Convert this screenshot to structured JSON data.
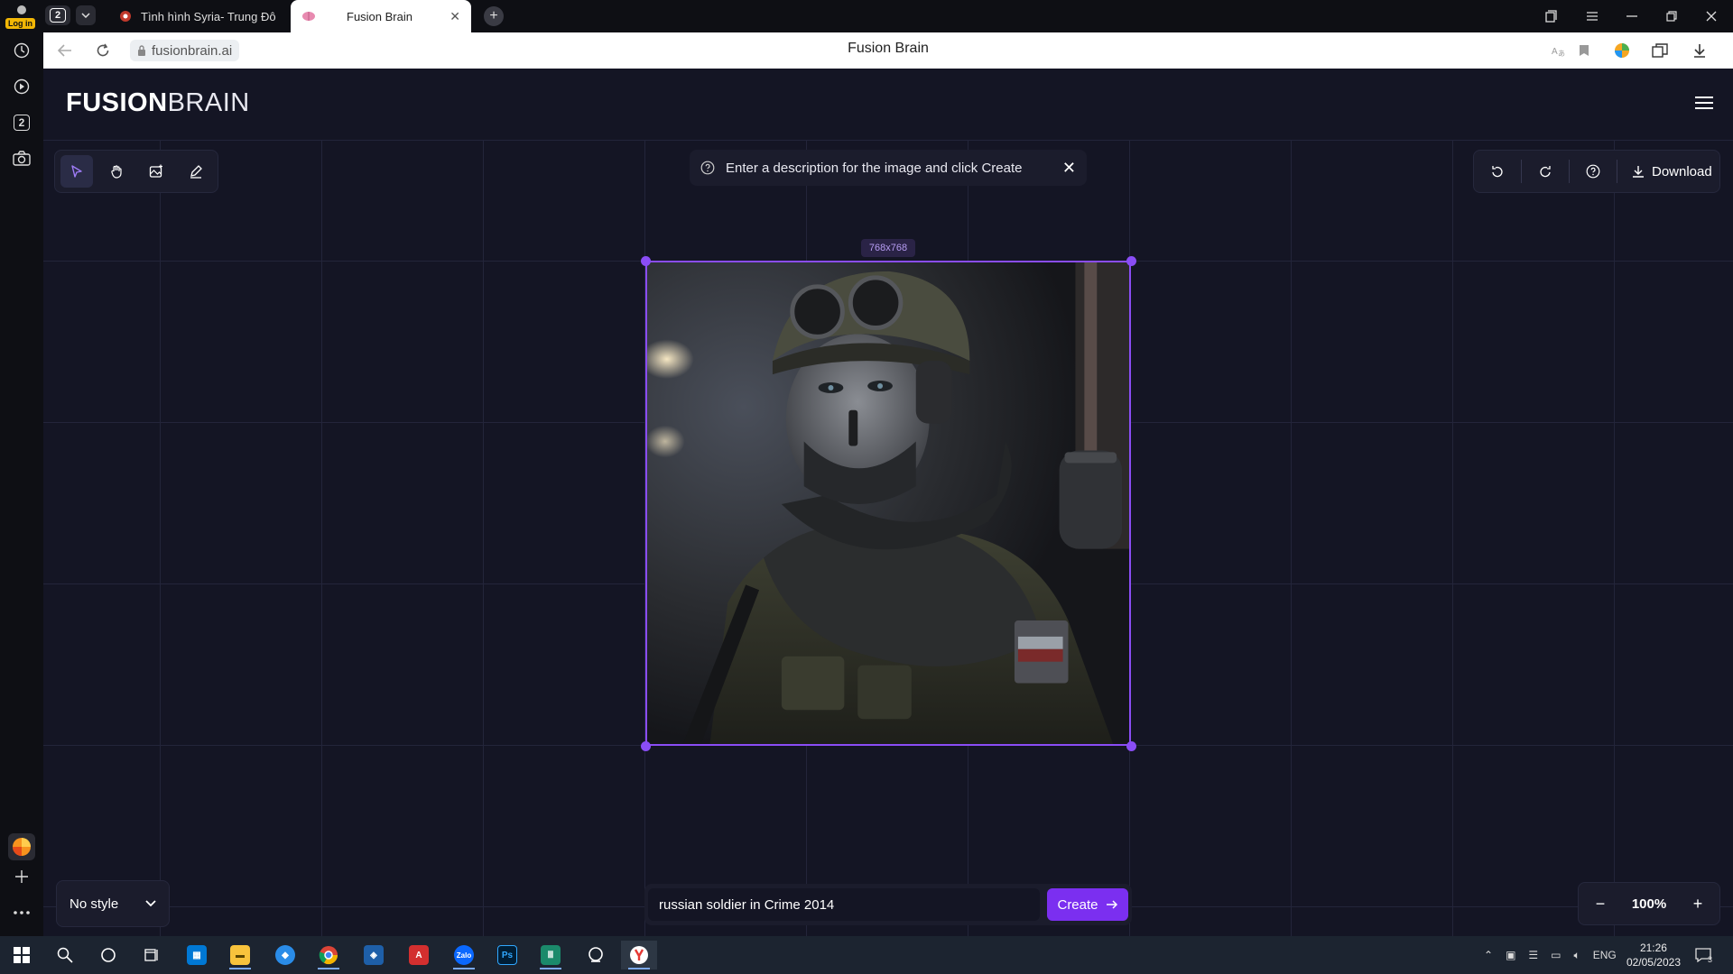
{
  "browser": {
    "profile_badge": "Log in",
    "tab_count": "2",
    "tabs": [
      {
        "title": "Tình hình Syria- Trung Đôn"
      },
      {
        "title": "Fusion Brain"
      }
    ],
    "url": "fusionbrain.ai",
    "page_title": "Fusion Brain",
    "sidebar_tab_count": "2"
  },
  "app": {
    "logo_bold": "FUSION",
    "logo_light": "BRAIN",
    "hint_text": "Enter a description for the image and click Create",
    "download_label": "Download",
    "image_size_label": "768x768",
    "style_label": "No style",
    "prompt_value": "russian soldier in Crime 2014",
    "create_label": "Create",
    "zoom_label": "100%",
    "zoom_minus": "−",
    "zoom_plus": "+"
  },
  "taskbar": {
    "language": "ENG",
    "time": "21:26",
    "date": "02/05/2023",
    "notification_count": "3",
    "apps": [
      "start-icon",
      "search-icon",
      "cortana-icon",
      "task-view-icon",
      "store-icon",
      "file-explorer-icon",
      "app-blue-icon",
      "chrome-icon",
      "app-shield-icon",
      "acrobat-icon",
      "zalo-icon",
      "photoshop-icon",
      "chart-app-icon",
      "app-globe-icon",
      "yandex-browser-icon"
    ]
  },
  "colors": {
    "accent": "#7b2ff0",
    "frame": "#8a4df5",
    "canvas_bg": "#141524",
    "panel_bg": "#1b1c2c"
  }
}
